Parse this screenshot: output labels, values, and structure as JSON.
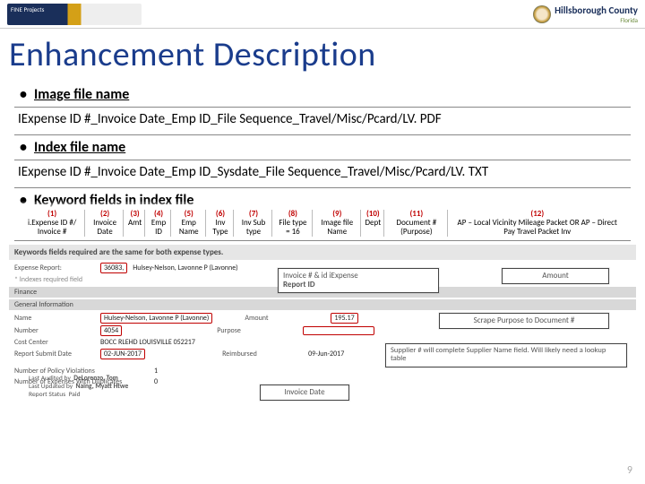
{
  "header": {
    "left_logo_text": "FINE Projects",
    "right_brand": "Hillsborough County",
    "right_sub": "Florida"
  },
  "title": "Enhancement Description",
  "bullets": {
    "image_label": "Image file name",
    "image_body": "IExpense ID #_Invoice Date_Emp ID_File Sequence_Travel/Misc/Pcard/LV. PDF",
    "index_label": "Index file name",
    "index_body": "IExpense ID #_Invoice Date_Emp ID_Sysdate_File Sequence_Travel/Misc/Pcard/LV. TXT",
    "keyword_label": "Keyword fields in index file"
  },
  "columns": [
    {
      "n": "(1)",
      "l": "i.Expense ID #/ Invoice #"
    },
    {
      "n": "(2)",
      "l": "Invoice Date"
    },
    {
      "n": "(3)",
      "l": "Amt"
    },
    {
      "n": "(4)",
      "l": "Emp ID"
    },
    {
      "n": "(5)",
      "l": "Emp Name"
    },
    {
      "n": "(6)",
      "l": "Inv Type"
    },
    {
      "n": "(7)",
      "l": "Inv Sub type"
    },
    {
      "n": "(8)",
      "l": "File type = 16"
    },
    {
      "n": "(9)",
      "l": "Image file Name"
    },
    {
      "n": "(10)",
      "l": "Dept"
    },
    {
      "n": "(11)",
      "l": "Document # (Purpose)"
    },
    {
      "n": "(12)",
      "l": "AP – Local Vicinity Mileage Packet OR AP – Direct Pay Travel Packet Inv"
    }
  ],
  "form": {
    "banner": "Keywords fields required are the same for both expense types.",
    "exp_report_label": "Expense Report:",
    "exp_report_val": "36083,",
    "exp_report_tail": "Hulsey-Nelson, Lavonne P (Lavonne)",
    "indexes_note": "* Indexes required field",
    "finance_strip": "Finance",
    "inv_id_label": "Invoice # & id iExpense",
    "report_id_label": "Report ID",
    "gen_strip": "General Information",
    "name_label": "Name",
    "name_val": "Hulsey-Nelson, Lavonne P (Lavonne)",
    "number_label": "Number",
    "number_val": "4054",
    "cc_label": "Cost Center",
    "cc_val": "BOCC RLEHD LOUISVILLE 052217",
    "report_submit_label": "Report Submit Date",
    "report_submit_val": "02-JUN-2017",
    "amount_label": "Amount",
    "amount_val": "195.17",
    "purpose_label": "Purpose",
    "reimb_label": "Reimbursed",
    "reimb_val": "09-Jun-2017",
    "policy_label": "Number of Policy Violations",
    "policy_val": "1",
    "exp_count_label": "Number of Expenses With Duplicates",
    "exp_count_val": "0",
    "last_audited_label": "Last Audited by",
    "last_audited_val": "DeLorenzo, Tom",
    "last_updated_label": "Last Updated by",
    "last_updated_val": "Naing, Myatt Htwe",
    "report_status_label": "Report Status",
    "report_status_val": "Paid"
  },
  "callouts": {
    "l1": "Invoice # & id iExpense Report ID",
    "r1": "Amount",
    "r2": "Scrape Purpose to Document #",
    "r3": "Supplier # will complete Supplier Name field. Will likely need a lookup table",
    "b1": "Invoice Date"
  },
  "page_number": "9"
}
